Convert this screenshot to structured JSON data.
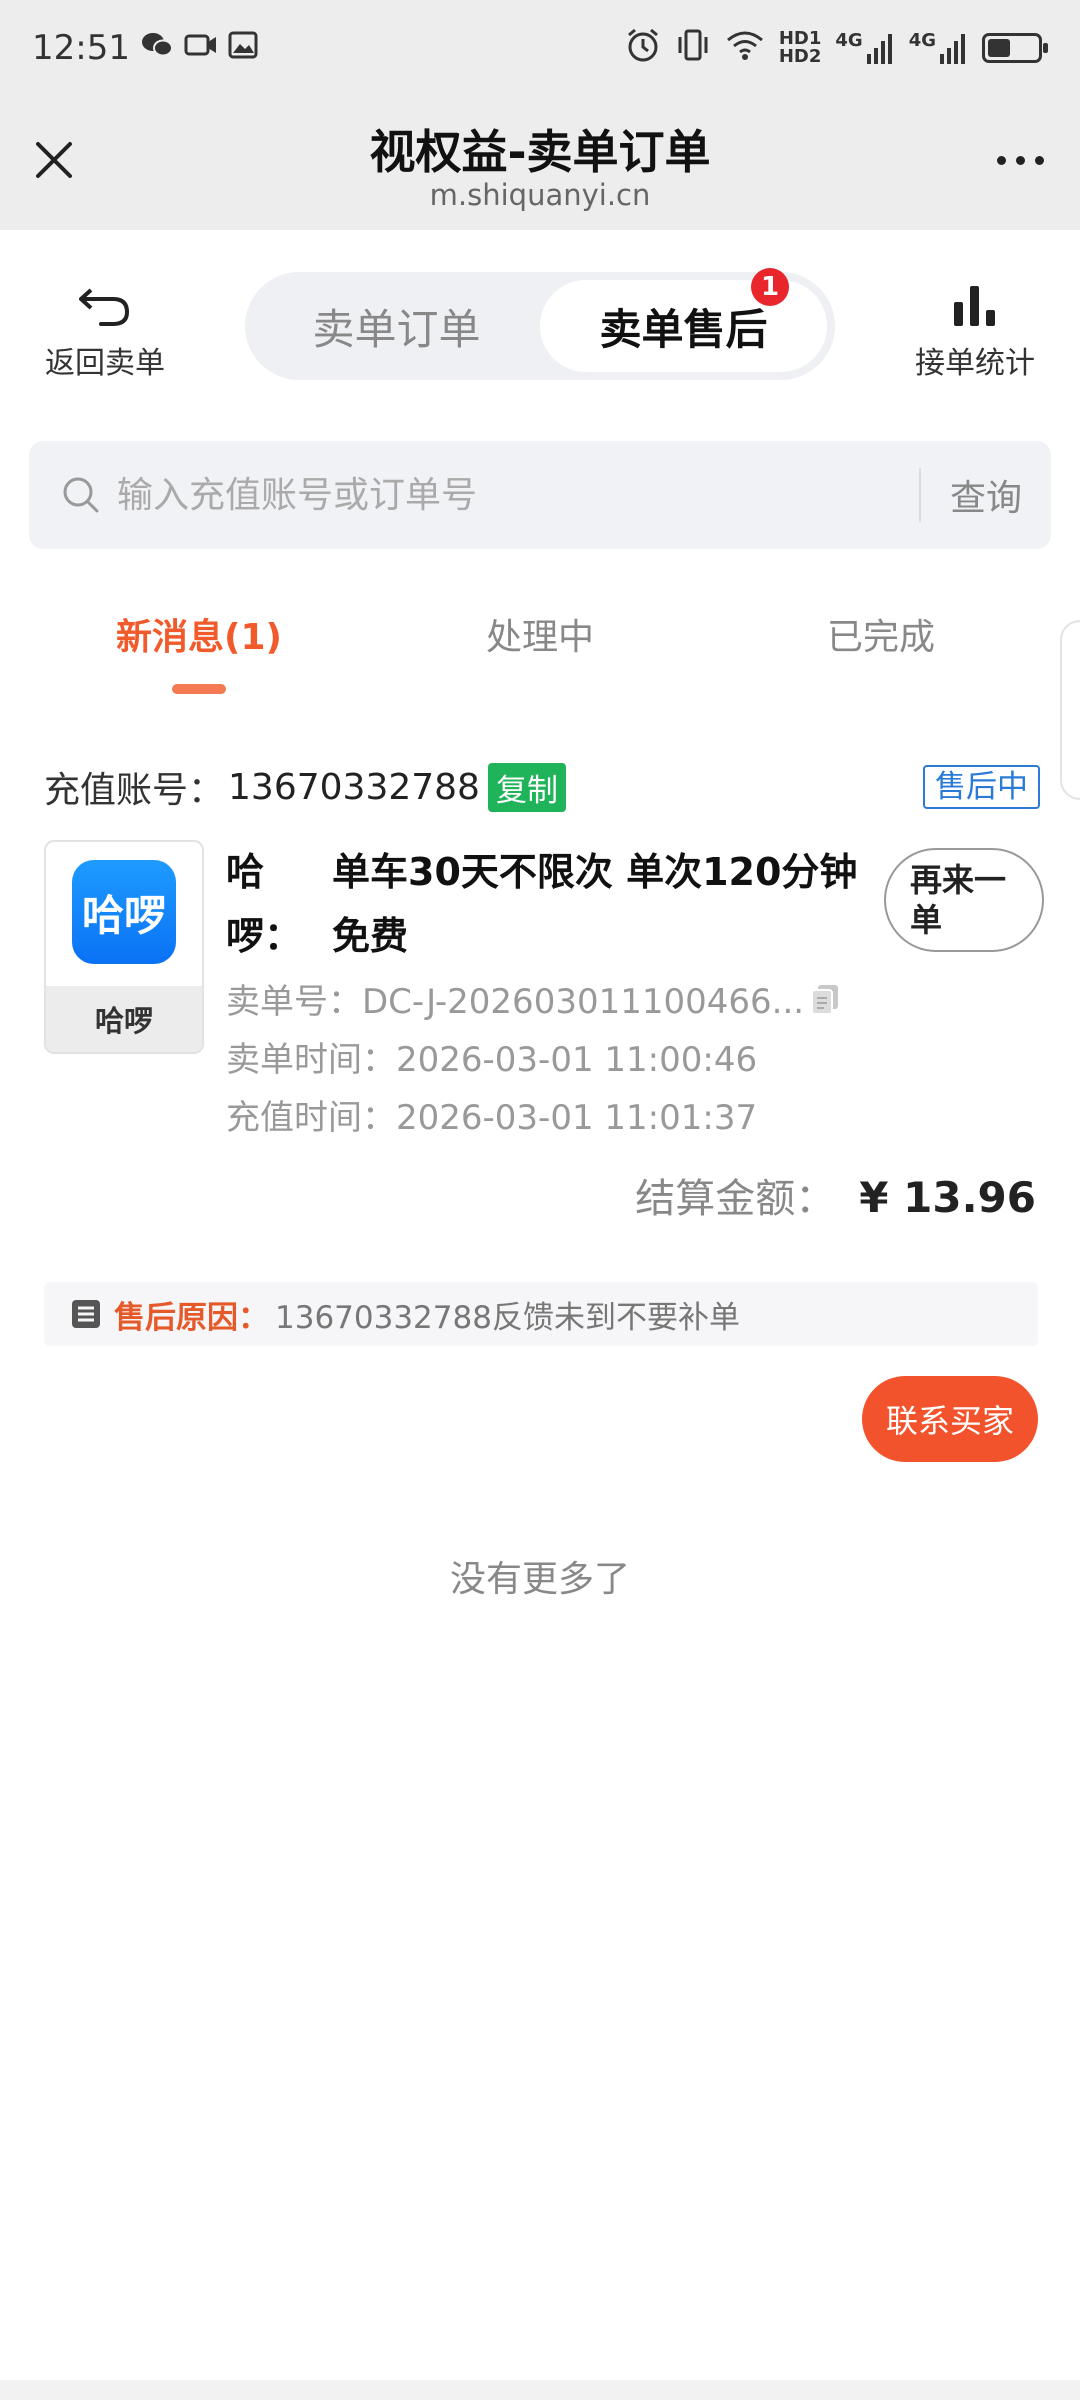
{
  "status_bar": {
    "time": "12:51",
    "network": {
      "hd1": "HD1",
      "hd2": "HD2",
      "g1": "4G",
      "g2": "4G"
    },
    "battery_level": 0.45
  },
  "header": {
    "title": "视权益-卖单订单",
    "url": "m.shiquanyi.cn"
  },
  "topnav": {
    "back_label": "返回卖单",
    "stats_label": "接单统计",
    "segments": [
      {
        "label": "卖单订单",
        "active": false
      },
      {
        "label": "卖单售后",
        "active": true,
        "badge": "1"
      }
    ]
  },
  "search": {
    "placeholder": "输入充值账号或订单号",
    "value": "",
    "button_label": "查询"
  },
  "subtabs": [
    {
      "label": "新消息(1)",
      "active": true
    },
    {
      "label": "处理中",
      "active": false
    },
    {
      "label": "已完成",
      "active": false
    }
  ],
  "order": {
    "account_label": "充值账号：",
    "account": "13670332788",
    "copy_label": "复制",
    "status": "售后中",
    "app_logo_text": "哈啰",
    "app_name": "哈啰",
    "product_name_line1": "哈",
    "product_name_line2": "啰：",
    "product_desc_line1": "单车30天不限次 单次120分钟",
    "product_desc_line2": "免费",
    "reorder_line1": "再来一",
    "reorder_line2": "单",
    "order_no_label": "卖单号：",
    "order_no": "DC-J-202603011100466...",
    "sell_time_label": "卖单时间：",
    "sell_time": "2026-03-01 11:00:46",
    "recharge_time_label": "充值时间：",
    "recharge_time": "2026-03-01 11:01:37",
    "amount_label": "结算金额：",
    "amount": "¥ 13.96",
    "reason_label": "售后原因：",
    "reason": "13670332788反馈未到不要补单",
    "contact_label": "联系买家"
  },
  "footer_text": "没有更多了",
  "colors": {
    "accent": "#f15a2b",
    "copy_green": "#1fb35a",
    "status_blue": "#2a7bd8",
    "badge_red": "#e8262c",
    "app_blue": "#0a72f5"
  }
}
